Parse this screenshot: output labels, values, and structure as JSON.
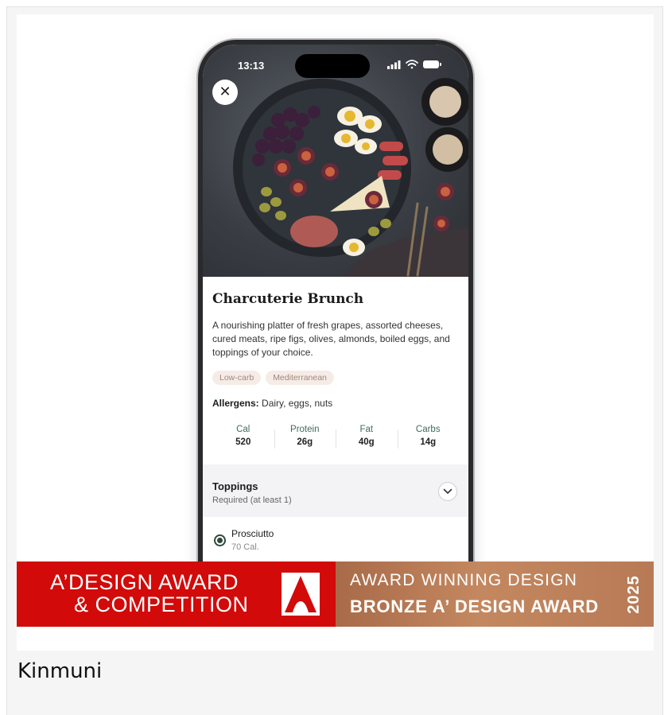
{
  "app": {
    "status_time": "13:13",
    "close_glyph": "✕",
    "dish": {
      "title": "Charcuterie Brunch",
      "description": "A nourishing platter of fresh grapes, assorted cheeses, cured meats, ripe figs, olives, almonds, boiled eggs, and toppings of your choice.",
      "tags": [
        "Low-carb",
        "Mediterranean"
      ],
      "allergens_label": "Allergens:",
      "allergens_value": "Dairy, eggs, nuts",
      "nutrition": [
        {
          "label": "Cal",
          "value": "520"
        },
        {
          "label": "Protein",
          "value": "26g"
        },
        {
          "label": "Fat",
          "value": "40g"
        },
        {
          "label": "Carbs",
          "value": "14g"
        }
      ]
    },
    "toppings": {
      "title": "Toppings",
      "subtitle": "Required (at least 1)",
      "options": [
        {
          "name": "Prosciutto",
          "calories": "70 Cal.",
          "selected": true
        }
      ]
    },
    "icons": [
      "close-icon",
      "signal-icon",
      "wifi-icon",
      "battery-icon",
      "chevron-down-icon",
      "radio-selected-icon"
    ]
  },
  "award_banner": {
    "line1": "A’DESIGN AWARD",
    "line2": "& COMPETITION",
    "right_line1": "AWARD WINNING DESIGN",
    "right_line2": "BRONZE A’ DESIGN AWARD",
    "year": "2025",
    "colors": {
      "red": "#d20a0a",
      "bronze": "#c48860"
    }
  },
  "caption": "Kinmuni"
}
